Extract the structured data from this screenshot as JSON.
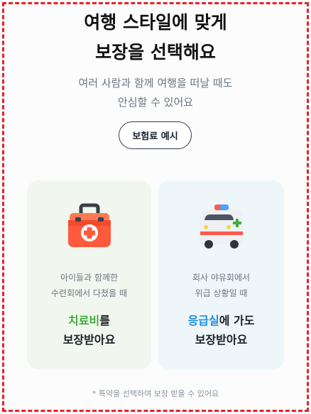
{
  "header": {
    "title_line1": "여행 스타일에 맞게",
    "title_line2": "보장을 선택해요",
    "subtitle_line1": "여러 사람과 함께 여행을 떠날 때도",
    "subtitle_line2": "안심할 수 있어요"
  },
  "example_button_label": "보험료 예시",
  "cards": [
    {
      "icon": "first-aid-kit-icon",
      "desc_line1": "아이들과 함께한",
      "desc_line2": "수련회에서 다쳤을 때",
      "highlight": "치료비",
      "headline_rest": "를",
      "headline_line2": "보장받아요",
      "accent": "#3fae3b"
    },
    {
      "icon": "ambulance-icon",
      "desc_line1": "회사 야유회에서",
      "desc_line2": "위급 상황일 때",
      "highlight": "응급실",
      "headline_rest": "에 가도",
      "headline_line2": "보장받아요",
      "accent": "#1b8fe6"
    }
  ],
  "footnote": "* 특약을 선택하여 보장 받을 수 있어요",
  "colors": {
    "frame_border": "#e8202a",
    "card_left_bg": "#f1f7ef",
    "card_right_bg": "#eef6f9"
  }
}
